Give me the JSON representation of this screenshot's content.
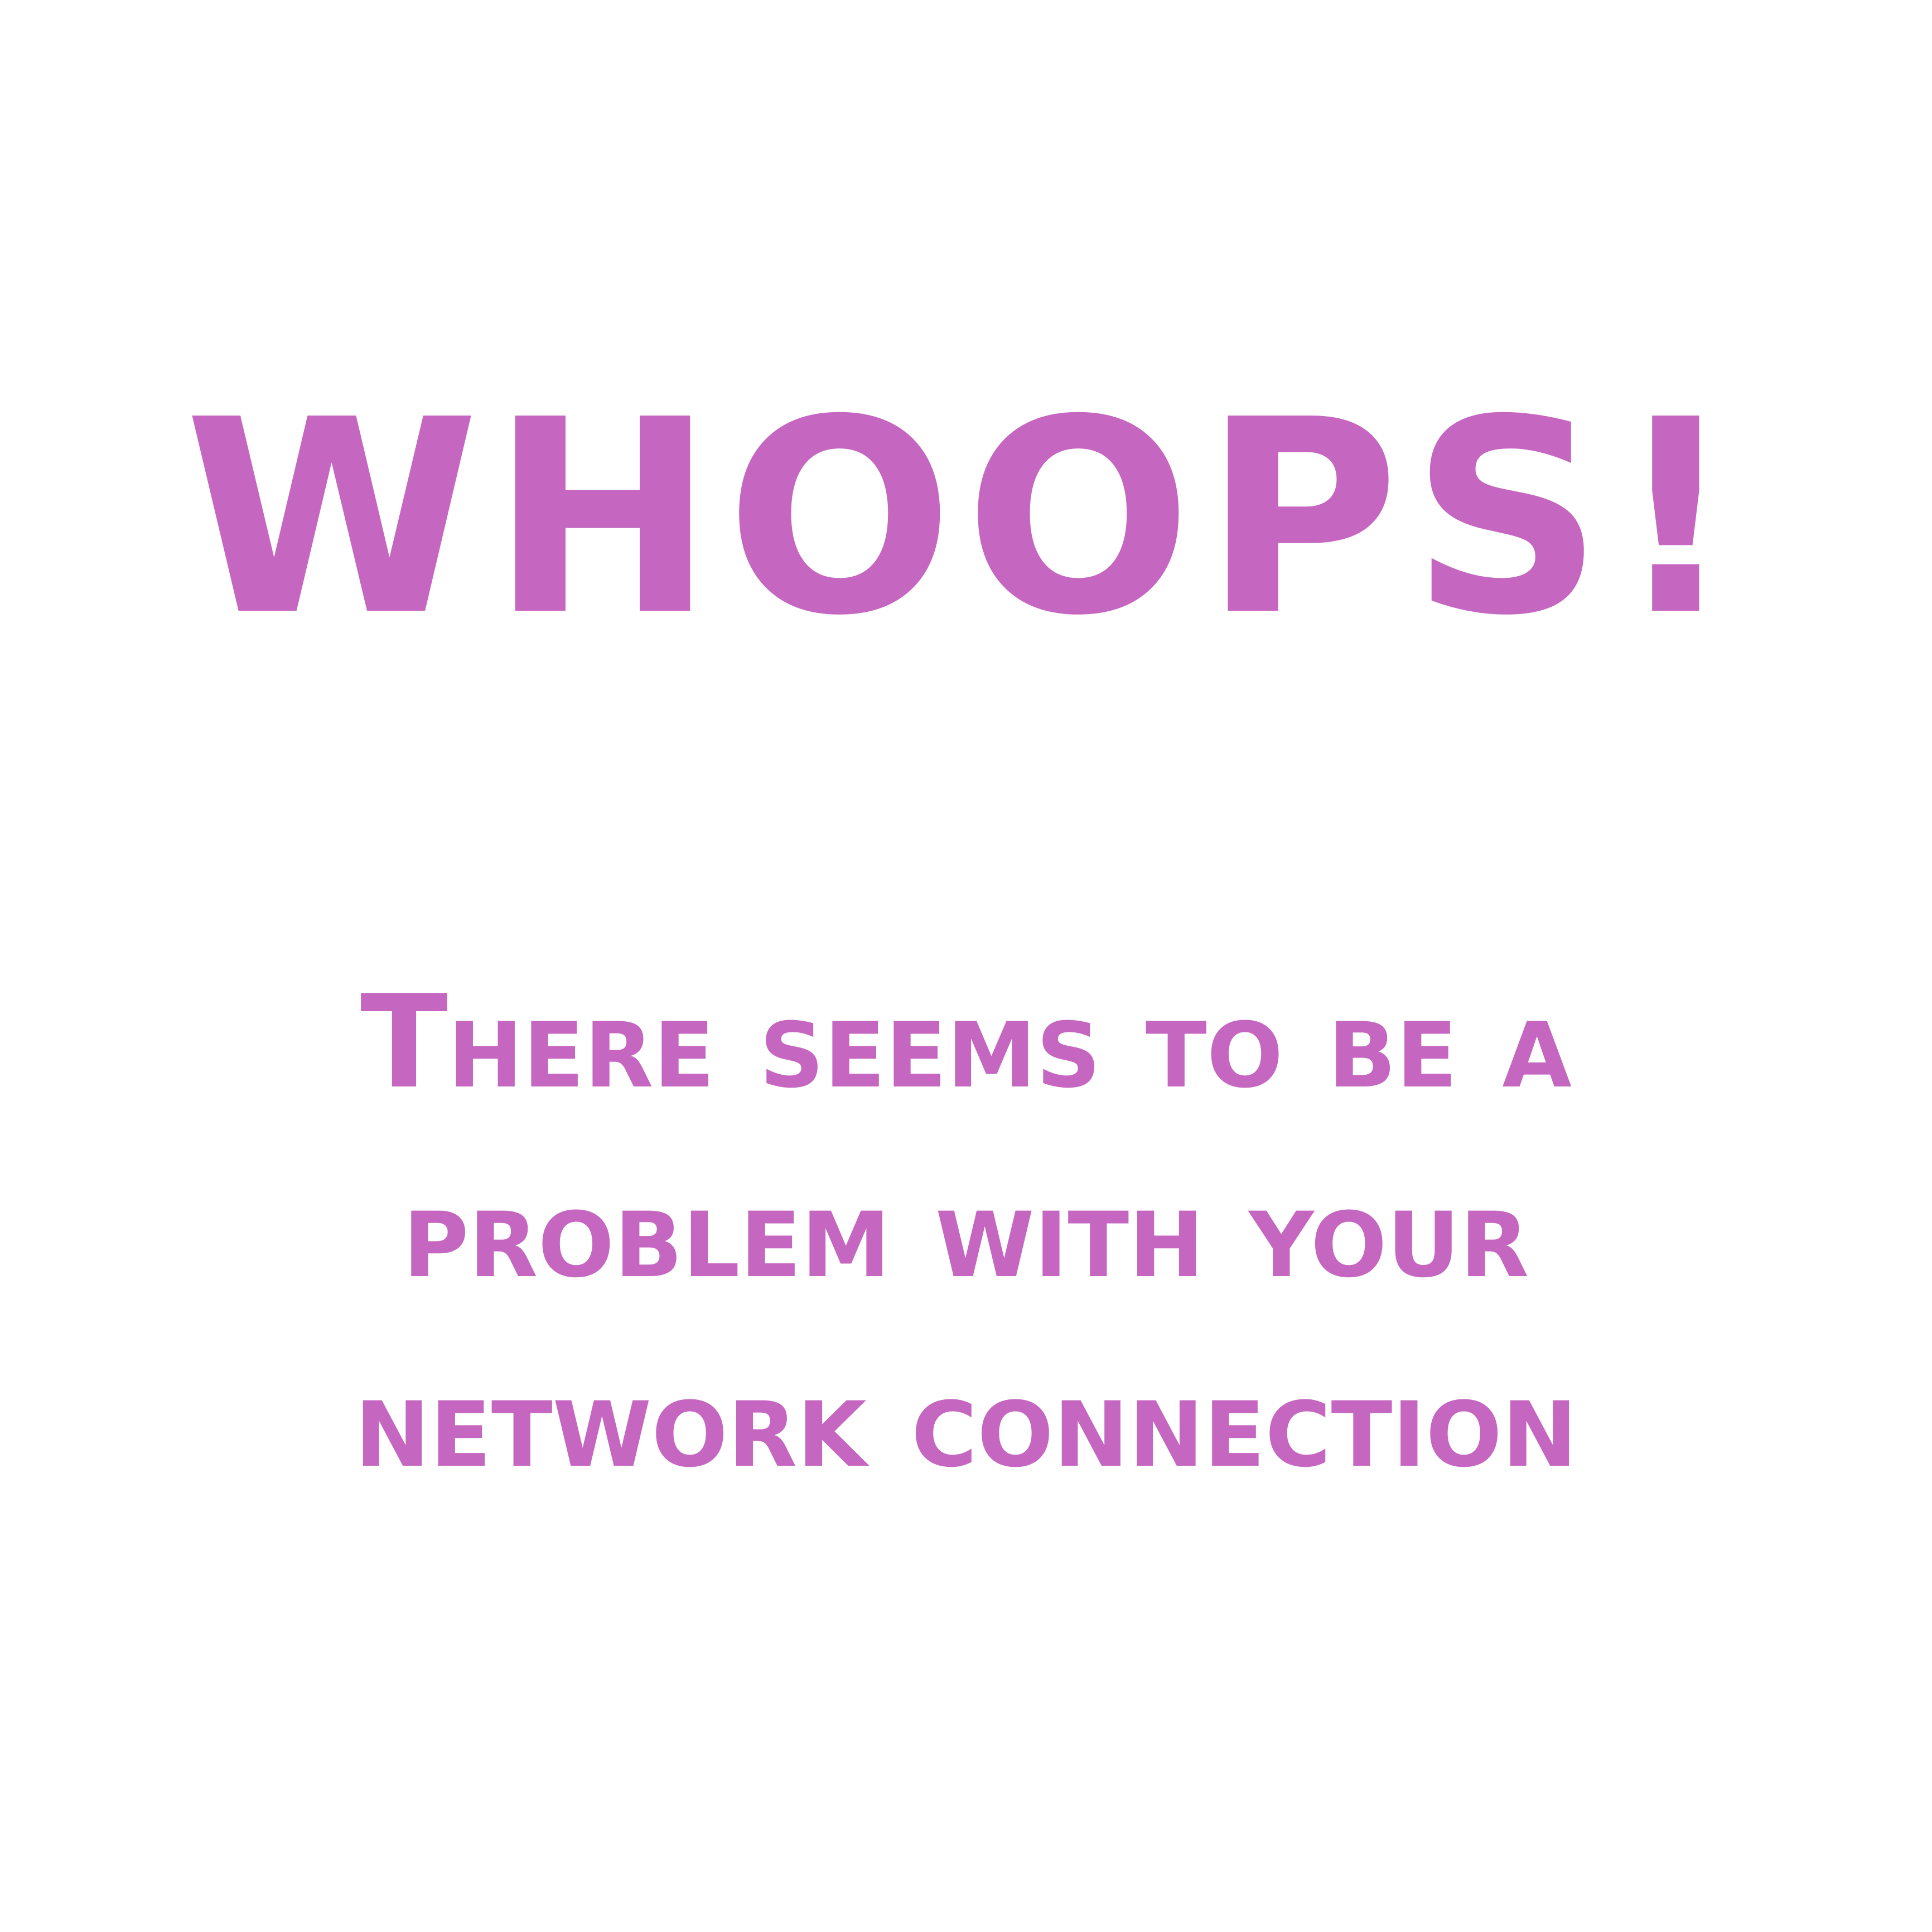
{
  "error": {
    "headline": "WHOOPS!",
    "message_lines": [
      "There seems to be a",
      "problem with your",
      "network connection"
    ]
  },
  "colors": {
    "text": "#c566c0",
    "background": "#ffffff"
  }
}
